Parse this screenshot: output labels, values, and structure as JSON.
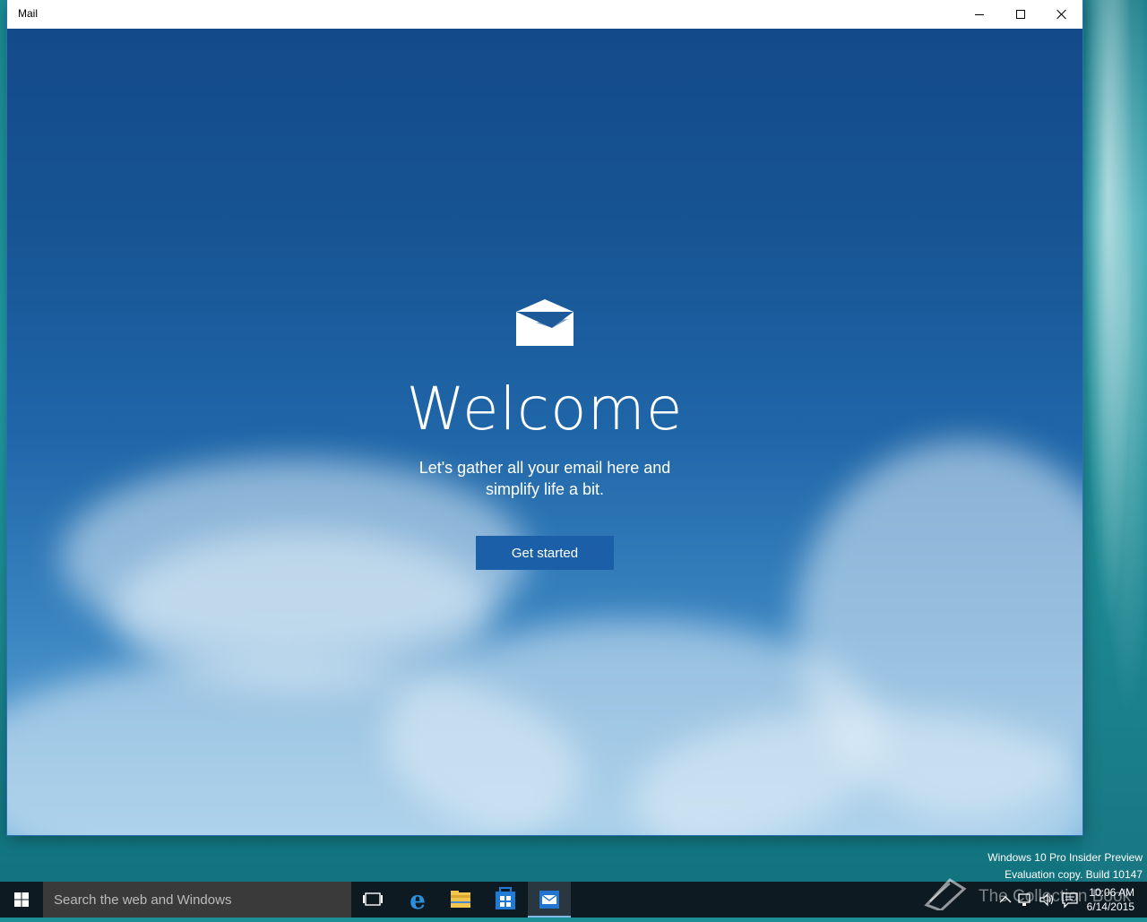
{
  "window": {
    "title": "Mail",
    "minimize_label": "Minimize",
    "maximize_label": "Maximize",
    "close_label": "Close"
  },
  "welcome": {
    "heading": "Welcome",
    "subtitle_line1": "Let's gather all your email here and",
    "subtitle_line2": "simplify life a bit.",
    "button_label": "Get started"
  },
  "watermark": {
    "line1": "Windows 10 Pro Insider Preview",
    "line2": "Evaluation copy. Build 10147"
  },
  "overlay_watermark": "The Collection Book",
  "taskbar": {
    "search_placeholder": "Search the web and Windows",
    "icons": [
      "start-icon",
      "task-view-icon",
      "edge-icon",
      "file-explorer-icon",
      "store-icon",
      "mail-icon"
    ],
    "active_app": "Mail",
    "tray_icons": [
      "chevron-up-icon",
      "network-icon",
      "volume-icon",
      "action-center-icon"
    ],
    "time": "10:06 AM",
    "date": "6/14/2015"
  },
  "colors": {
    "accent": "#1b5fa8",
    "taskbar": "#0e1a22",
    "search_bg": "#3a3a3a"
  }
}
